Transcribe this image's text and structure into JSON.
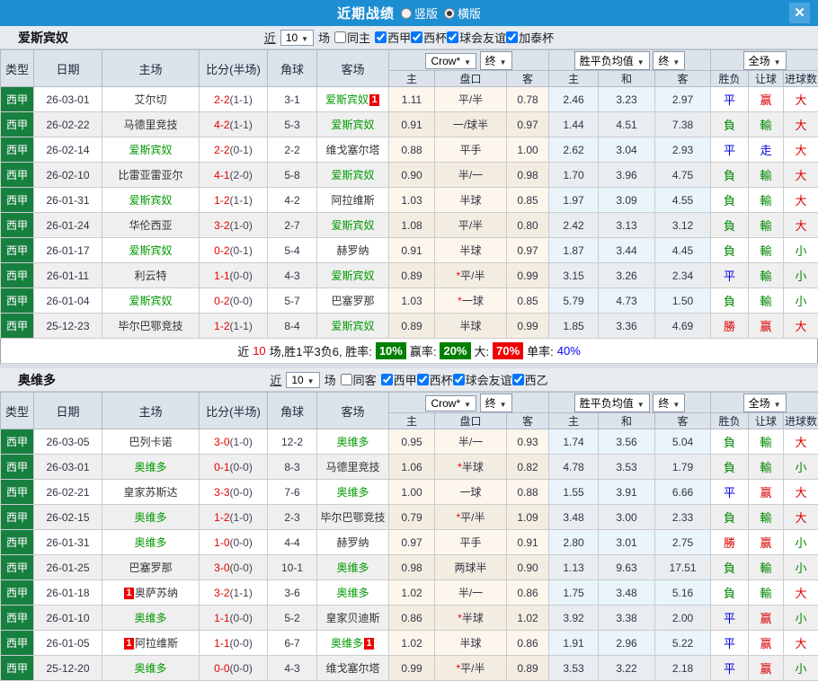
{
  "titlebar": {
    "title": "近期战绩",
    "vertical_label": "竖版",
    "vertical_selected": false,
    "horizontal_label": "横版",
    "horizontal_selected": true,
    "close_label": "✕"
  },
  "header_labels": {
    "type": "类型",
    "date": "日期",
    "home": "主场",
    "score": "比分(半场)",
    "corner": "角球",
    "away": "客场",
    "bookmaker": "Crow*",
    "stage1": "终",
    "avg": "胜平负均值",
    "stage2": "终",
    "scope": "全场",
    "sub": [
      "主",
      "盘口",
      "客",
      "主",
      "和",
      "客",
      "胜负",
      "让球",
      "进球数"
    ]
  },
  "colors": {
    "titlebar_blue": "#1e8ed2",
    "league_green": "#17803f",
    "team_green": "#009900",
    "score_red": "#e60000",
    "badge_red": "#ee0000",
    "result_red": "#dd0000",
    "result_blue": "#0000dd",
    "result_green": "#008800",
    "asian_odds_bg": "#fdf6ec",
    "euro_odds_bg": "#e9f4fb",
    "summary_green": "#008000",
    "summary_red": "#f00000",
    "summary_blue": "#0000ff"
  },
  "sections": [
    {
      "team": "爱斯宾奴",
      "filter": {
        "near": "近",
        "count": "10",
        "unit": "场",
        "same": {
          "label": "同主",
          "checked": false
        },
        "leagues": [
          {
            "label": "西甲",
            "checked": true
          },
          {
            "label": "西杯",
            "checked": true
          },
          {
            "label": "球会友谊",
            "checked": true
          },
          {
            "label": "加泰杯",
            "checked": true
          }
        ]
      },
      "rows": [
        {
          "league": "西甲",
          "date": "26-03-01",
          "home": {
            "name": "艾尔切",
            "green": false,
            "badge": ""
          },
          "score": "2-2",
          "half": "(1-1)",
          "corner": "3-1",
          "away": {
            "name": "爱斯宾奴",
            "green": true,
            "badge": "1"
          },
          "asian": [
            "1.11",
            "平/半",
            "0.78"
          ],
          "asian_star": false,
          "euro": [
            "2.46",
            "3.23",
            "2.97"
          ],
          "results": [
            "平",
            "赢",
            "大"
          ]
        },
        {
          "league": "西甲",
          "date": "26-02-22",
          "home": {
            "name": "马德里竞技",
            "green": false,
            "badge": ""
          },
          "score": "4-2",
          "half": "(1-1)",
          "corner": "5-3",
          "away": {
            "name": "爱斯宾奴",
            "green": true,
            "badge": ""
          },
          "asian": [
            "0.91",
            "一/球半",
            "0.97"
          ],
          "asian_star": false,
          "euro": [
            "1.44",
            "4.51",
            "7.38"
          ],
          "results": [
            "負",
            "輸",
            "大"
          ]
        },
        {
          "league": "西甲",
          "date": "26-02-14",
          "home": {
            "name": "爱斯宾奴",
            "green": true,
            "badge": ""
          },
          "score": "2-2",
          "half": "(0-1)",
          "corner": "2-2",
          "away": {
            "name": "维戈塞尔塔",
            "green": false,
            "badge": ""
          },
          "asian": [
            "0.88",
            "平手",
            "1.00"
          ],
          "asian_star": false,
          "euro": [
            "2.62",
            "3.04",
            "2.93"
          ],
          "results": [
            "平",
            "走",
            "大"
          ]
        },
        {
          "league": "西甲",
          "date": "26-02-10",
          "home": {
            "name": "比雷亚雷亚尔",
            "green": false,
            "badge": ""
          },
          "score": "4-1",
          "half": "(2-0)",
          "corner": "5-8",
          "away": {
            "name": "爱斯宾奴",
            "green": true,
            "badge": ""
          },
          "asian": [
            "0.90",
            "半/一",
            "0.98"
          ],
          "asian_star": false,
          "euro": [
            "1.70",
            "3.96",
            "4.75"
          ],
          "results": [
            "負",
            "輸",
            "大"
          ]
        },
        {
          "league": "西甲",
          "date": "26-01-31",
          "home": {
            "name": "爱斯宾奴",
            "green": true,
            "badge": ""
          },
          "score": "1-2",
          "half": "(1-1)",
          "corner": "4-2",
          "away": {
            "name": "阿拉维斯",
            "green": false,
            "badge": ""
          },
          "asian": [
            "1.03",
            "半球",
            "0.85"
          ],
          "asian_star": false,
          "euro": [
            "1.97",
            "3.09",
            "4.55"
          ],
          "results": [
            "負",
            "輸",
            "大"
          ]
        },
        {
          "league": "西甲",
          "date": "26-01-24",
          "home": {
            "name": "华伦西亚",
            "green": false,
            "badge": ""
          },
          "score": "3-2",
          "half": "(1-0)",
          "corner": "2-7",
          "away": {
            "name": "爱斯宾奴",
            "green": true,
            "badge": ""
          },
          "asian": [
            "1.08",
            "平/半",
            "0.80"
          ],
          "asian_star": false,
          "euro": [
            "2.42",
            "3.13",
            "3.12"
          ],
          "results": [
            "負",
            "輸",
            "大"
          ]
        },
        {
          "league": "西甲",
          "date": "26-01-17",
          "home": {
            "name": "爱斯宾奴",
            "green": true,
            "badge": ""
          },
          "score": "0-2",
          "half": "(0-1)",
          "corner": "5-4",
          "away": {
            "name": "赫罗纳",
            "green": false,
            "badge": ""
          },
          "asian": [
            "0.91",
            "半球",
            "0.97"
          ],
          "asian_star": false,
          "euro": [
            "1.87",
            "3.44",
            "4.45"
          ],
          "results": [
            "負",
            "輸",
            "小"
          ]
        },
        {
          "league": "西甲",
          "date": "26-01-11",
          "home": {
            "name": "利云特",
            "green": false,
            "badge": ""
          },
          "score": "1-1",
          "half": "(0-0)",
          "corner": "4-3",
          "away": {
            "name": "爱斯宾奴",
            "green": true,
            "badge": ""
          },
          "asian": [
            "0.89",
            "平/半",
            "0.99"
          ],
          "asian_star": true,
          "euro": [
            "3.15",
            "3.26",
            "2.34"
          ],
          "results": [
            "平",
            "輸",
            "小"
          ]
        },
        {
          "league": "西甲",
          "date": "26-01-04",
          "home": {
            "name": "爱斯宾奴",
            "green": true,
            "badge": ""
          },
          "score": "0-2",
          "half": "(0-0)",
          "corner": "5-7",
          "away": {
            "name": "巴塞罗那",
            "green": false,
            "badge": ""
          },
          "asian": [
            "1.03",
            "一球",
            "0.85"
          ],
          "asian_star": true,
          "euro": [
            "5.79",
            "4.73",
            "1.50"
          ],
          "results": [
            "負",
            "輸",
            "小"
          ]
        },
        {
          "league": "西甲",
          "date": "25-12-23",
          "home": {
            "name": "毕尔巴鄂竞技",
            "green": false,
            "badge": ""
          },
          "score": "1-2",
          "half": "(1-1)",
          "corner": "8-4",
          "away": {
            "name": "爱斯宾奴",
            "green": true,
            "badge": ""
          },
          "asian": [
            "0.89",
            "半球",
            "0.99"
          ],
          "asian_star": false,
          "euro": [
            "1.85",
            "3.36",
            "4.69"
          ],
          "results": [
            "勝",
            "赢",
            "大"
          ]
        }
      ],
      "summary": {
        "near": "近",
        "count": "10",
        "record": "场,胜1平3负6, 胜率:",
        "win_pct": "10%",
        "cover_label": "赢率:",
        "cover_pct": "20%",
        "big_label": "大:",
        "big_pct": "70%",
        "single_label": "单率:",
        "single_pct": "40%"
      }
    },
    {
      "team": "奥维多",
      "filter": {
        "near": "近",
        "count": "10",
        "unit": "场",
        "same": {
          "label": "同客",
          "checked": false
        },
        "leagues": [
          {
            "label": "西甲",
            "checked": true
          },
          {
            "label": "西杯",
            "checked": true
          },
          {
            "label": "球会友谊",
            "checked": true
          },
          {
            "label": "西乙",
            "checked": true
          }
        ]
      },
      "rows": [
        {
          "league": "西甲",
          "date": "26-03-05",
          "home": {
            "name": "巴列卡诺",
            "green": false,
            "badge": ""
          },
          "score": "3-0",
          "half": "(1-0)",
          "corner": "12-2",
          "away": {
            "name": "奥维多",
            "green": true,
            "badge": ""
          },
          "asian": [
            "0.95",
            "半/一",
            "0.93"
          ],
          "asian_star": false,
          "euro": [
            "1.74",
            "3.56",
            "5.04"
          ],
          "results": [
            "負",
            "輸",
            "大"
          ]
        },
        {
          "league": "西甲",
          "date": "26-03-01",
          "home": {
            "name": "奥维多",
            "green": true,
            "badge": ""
          },
          "score": "0-1",
          "half": "(0-0)",
          "corner": "8-3",
          "away": {
            "name": "马德里竞技",
            "green": false,
            "badge": ""
          },
          "asian": [
            "1.06",
            "半球",
            "0.82"
          ],
          "asian_star": true,
          "euro": [
            "4.78",
            "3.53",
            "1.79"
          ],
          "results": [
            "負",
            "輸",
            "小"
          ]
        },
        {
          "league": "西甲",
          "date": "26-02-21",
          "home": {
            "name": "皇家苏斯达",
            "green": false,
            "badge": ""
          },
          "score": "3-3",
          "half": "(0-0)",
          "corner": "7-6",
          "away": {
            "name": "奥维多",
            "green": true,
            "badge": ""
          },
          "asian": [
            "1.00",
            "一球",
            "0.88"
          ],
          "asian_star": false,
          "euro": [
            "1.55",
            "3.91",
            "6.66"
          ],
          "results": [
            "平",
            "赢",
            "大"
          ]
        },
        {
          "league": "西甲",
          "date": "26-02-15",
          "home": {
            "name": "奥维多",
            "green": true,
            "badge": ""
          },
          "score": "1-2",
          "half": "(1-0)",
          "corner": "2-3",
          "away": {
            "name": "毕尔巴鄂竞技",
            "green": false,
            "badge": ""
          },
          "asian": [
            "0.79",
            "平/半",
            "1.09"
          ],
          "asian_star": true,
          "euro": [
            "3.48",
            "3.00",
            "2.33"
          ],
          "results": [
            "負",
            "輸",
            "大"
          ]
        },
        {
          "league": "西甲",
          "date": "26-01-31",
          "home": {
            "name": "奥维多",
            "green": true,
            "badge": ""
          },
          "score": "1-0",
          "half": "(0-0)",
          "corner": "4-4",
          "away": {
            "name": "赫罗纳",
            "green": false,
            "badge": ""
          },
          "asian": [
            "0.97",
            "平手",
            "0.91"
          ],
          "asian_star": false,
          "euro": [
            "2.80",
            "3.01",
            "2.75"
          ],
          "results": [
            "勝",
            "赢",
            "小"
          ]
        },
        {
          "league": "西甲",
          "date": "26-01-25",
          "home": {
            "name": "巴塞罗那",
            "green": false,
            "badge": ""
          },
          "score": "3-0",
          "half": "(0-0)",
          "corner": "10-1",
          "away": {
            "name": "奥维多",
            "green": true,
            "badge": ""
          },
          "asian": [
            "0.98",
            "两球半",
            "0.90"
          ],
          "asian_star": false,
          "euro": [
            "1.13",
            "9.63",
            "17.51"
          ],
          "results": [
            "負",
            "輸",
            "小"
          ]
        },
        {
          "league": "西甲",
          "date": "26-01-18",
          "home": {
            "name": "奥萨苏纳",
            "green": false,
            "badge": "1"
          },
          "score": "3-2",
          "half": "(1-1)",
          "corner": "3-6",
          "away": {
            "name": "奥维多",
            "green": true,
            "badge": ""
          },
          "asian": [
            "1.02",
            "半/一",
            "0.86"
          ],
          "asian_star": false,
          "euro": [
            "1.75",
            "3.48",
            "5.16"
          ],
          "results": [
            "負",
            "輸",
            "大"
          ]
        },
        {
          "league": "西甲",
          "date": "26-01-10",
          "home": {
            "name": "奥维多",
            "green": true,
            "badge": ""
          },
          "score": "1-1",
          "half": "(0-0)",
          "corner": "5-2",
          "away": {
            "name": "皇家贝迪斯",
            "green": false,
            "badge": ""
          },
          "asian": [
            "0.86",
            "半球",
            "1.02"
          ],
          "asian_star": true,
          "euro": [
            "3.92",
            "3.38",
            "2.00"
          ],
          "results": [
            "平",
            "赢",
            "小"
          ]
        },
        {
          "league": "西甲",
          "date": "26-01-05",
          "home": {
            "name": "阿拉维斯",
            "green": false,
            "badge": "1"
          },
          "score": "1-1",
          "half": "(0-0)",
          "corner": "6-7",
          "away": {
            "name": "奥维多",
            "green": true,
            "badge": "1"
          },
          "asian": [
            "1.02",
            "半球",
            "0.86"
          ],
          "asian_star": false,
          "euro": [
            "1.91",
            "2.96",
            "5.22"
          ],
          "results": [
            "平",
            "赢",
            "大"
          ]
        },
        {
          "league": "西甲",
          "date": "25-12-20",
          "home": {
            "name": "奥维多",
            "green": true,
            "badge": ""
          },
          "score": "0-0",
          "half": "(0-0)",
          "corner": "4-3",
          "away": {
            "name": "维戈塞尔塔",
            "green": false,
            "badge": ""
          },
          "asian": [
            "0.99",
            "平/半",
            "0.89"
          ],
          "asian_star": true,
          "euro": [
            "3.53",
            "3.22",
            "2.18"
          ],
          "results": [
            "平",
            "赢",
            "小"
          ]
        }
      ],
      "summary": null
    }
  ]
}
